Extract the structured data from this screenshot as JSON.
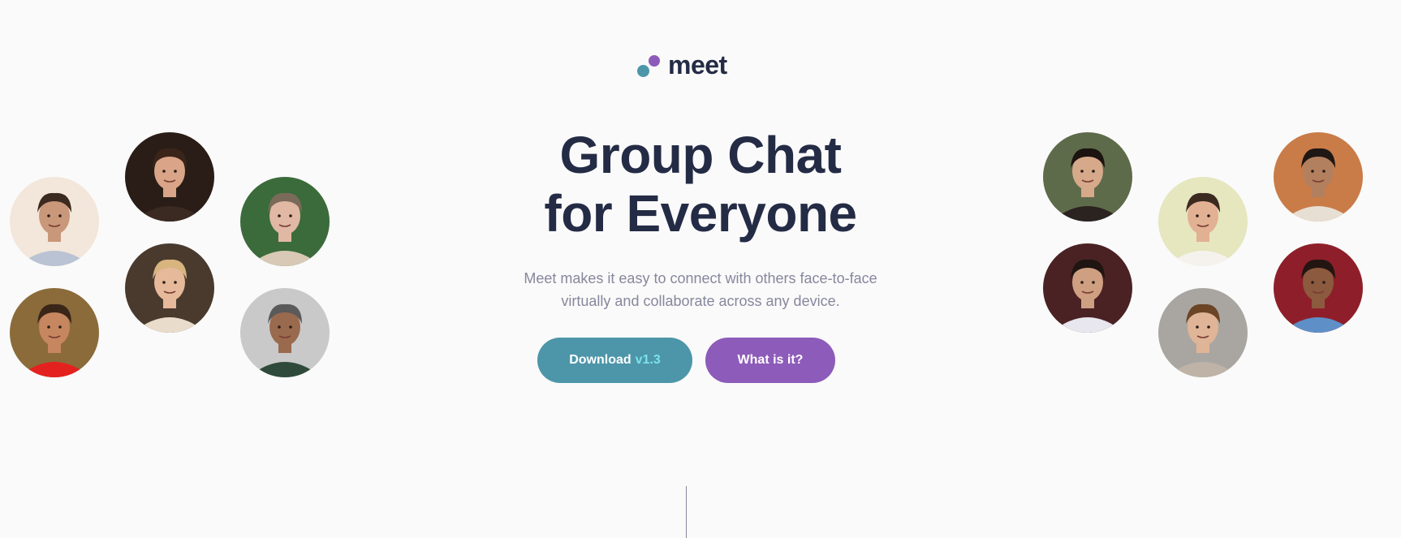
{
  "brand": {
    "name": "meet",
    "colors": {
      "teal": "#4d96a9",
      "purple": "#8d5bb9",
      "dark": "#242b45",
      "gray": "#87879d",
      "cyan": "#79e3e7"
    }
  },
  "hero": {
    "title_line1": "Group Chat",
    "title_line2": "for Everyone",
    "description": "Meet makes it easy to connect with others face-to-face virtually and collaborate across any device."
  },
  "buttons": {
    "download_label": "Download",
    "download_version": "v1.3",
    "what_label": "What is it?"
  },
  "avatars_left": [
    {
      "bg": "#f3e6da",
      "skin": "#c9977a",
      "hair": "#3b2a20",
      "shirt": "#b9c3d3"
    },
    {
      "bg": "#2a1d17",
      "skin": "#d9a487",
      "hair": "#3b251a",
      "shirt": "#3a2a22"
    },
    {
      "bg": "#3b6b3b",
      "skin": "#e0b8a3",
      "hair": "#7a6a5a",
      "shirt": "#d7c9b5"
    },
    {
      "bg": "#8b6b3a",
      "skin": "#c6865f",
      "hair": "#3a2618",
      "shirt": "#e3221f"
    },
    {
      "bg": "#4a3a2e",
      "skin": "#e6b99a",
      "hair": "#d8b47f",
      "shirt": "#e9dccb"
    },
    {
      "bg": "#c9c9c9",
      "skin": "#9a6a4e",
      "hair": "#5a5a5a",
      "shirt": "#2f4a3a"
    }
  ],
  "avatars_right": [
    {
      "bg": "#5e6b4a",
      "skin": "#d6a98a",
      "hair": "#1c1410",
      "shirt": "#2a2320"
    },
    {
      "bg": "#e6e6bf",
      "skin": "#e2b092",
      "hair": "#3b2a20",
      "shirt": "#f5f2ee"
    },
    {
      "bg": "#c97c48",
      "skin": "#b3805f",
      "hair": "#1f1714",
      "shirt": "#e7dfd3"
    },
    {
      "bg": "#4a2224",
      "skin": "#cf9f82",
      "hair": "#1f1512",
      "shirt": "#e8e6ee"
    },
    {
      "bg": "#a9a6a2",
      "skin": "#e0b496",
      "hair": "#6b4526",
      "shirt": "#bfb3a8"
    },
    {
      "bg": "#8e1f2a",
      "skin": "#8c5a3e",
      "hair": "#231511",
      "shirt": "#5e8fc7"
    }
  ]
}
